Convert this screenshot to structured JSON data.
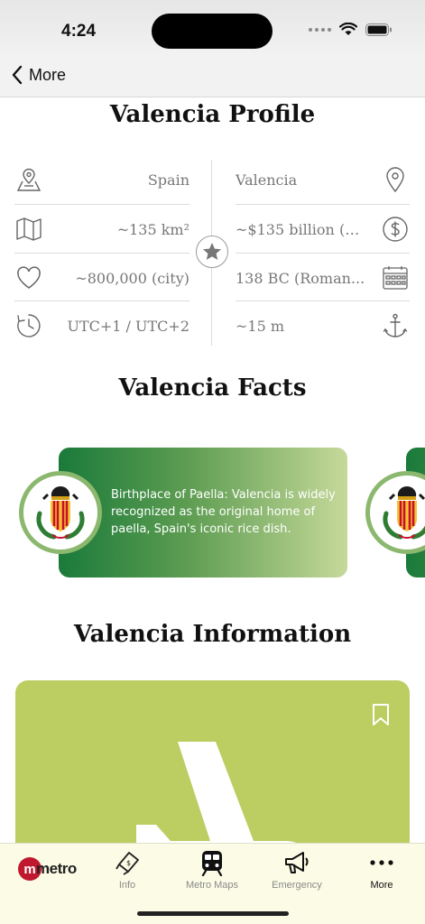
{
  "status_bar": {
    "time": "4:24"
  },
  "nav": {
    "back_label": "More"
  },
  "profile": {
    "title": "Valencia Profile",
    "left": [
      {
        "icon": "map-pin-flag-icon",
        "value": "Spain"
      },
      {
        "icon": "map-icon",
        "value": "~135 km²"
      },
      {
        "icon": "heart-icon",
        "value": "~800,000 (city)"
      },
      {
        "icon": "clock-icon",
        "value": "UTC+1 / UTC+2"
      }
    ],
    "right": [
      {
        "icon": "location-pin-icon",
        "value": "Valencia"
      },
      {
        "icon": "dollar-icon",
        "value": "~$135 billion (R..."
      },
      {
        "icon": "calendar-icon",
        "value": "138 BC (Roman..."
      },
      {
        "icon": "anchor-icon",
        "value": "~15 m"
      }
    ]
  },
  "facts": {
    "title": "Valencia Facts",
    "items": [
      {
        "text": "Birthplace of Paella: Valencia is widely recognized as the original home of paella, Spain's iconic rice dish."
      }
    ]
  },
  "information": {
    "title": "Valencia Information"
  },
  "tab_bar": {
    "logo_text": "metro",
    "logo_letter": "m",
    "tabs": [
      {
        "label": "Info",
        "icon": "ticket-icon"
      },
      {
        "label": "Metro Maps",
        "icon": "train-icon"
      },
      {
        "label": "Emergency",
        "icon": "megaphone-icon"
      },
      {
        "label": "More",
        "icon": "more-dots-icon",
        "active": true
      }
    ]
  },
  "colors": {
    "card_green": "#bccd62",
    "fact_gradient_start": "#1a7a3a",
    "fact_gradient_end": "#c6d99a",
    "logo_red": "#c0182e"
  }
}
